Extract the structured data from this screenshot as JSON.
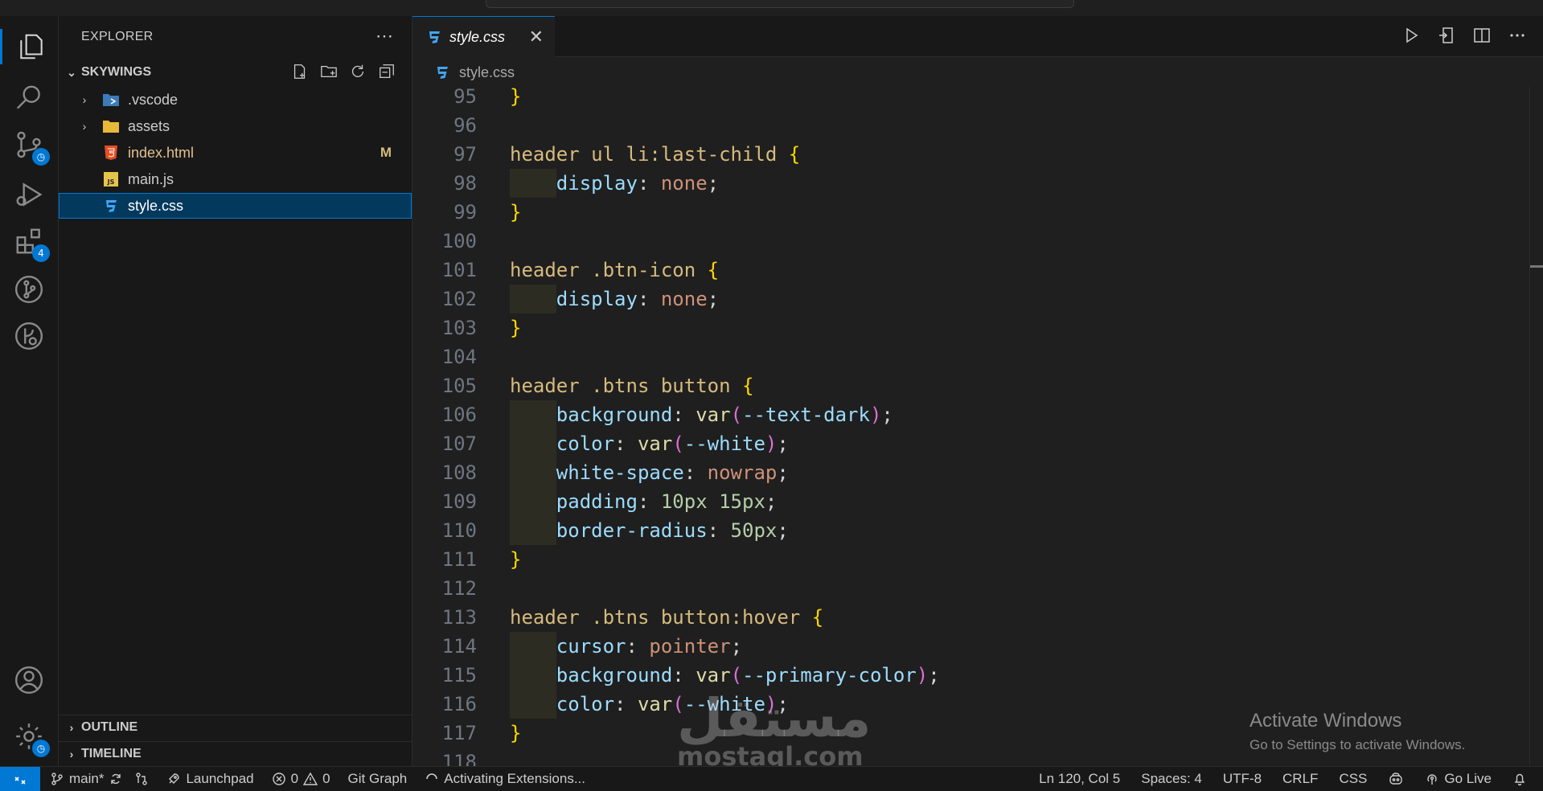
{
  "explorer": {
    "title": "EXPLORER",
    "workspace": "SKYWINGS",
    "items": [
      {
        "label": ".vscode",
        "type": "folder",
        "git": ""
      },
      {
        "label": "assets",
        "type": "folder",
        "git": ""
      },
      {
        "label": "index.html",
        "type": "html",
        "git": "M"
      },
      {
        "label": "main.js",
        "type": "js",
        "git": ""
      },
      {
        "label": "style.css",
        "type": "css",
        "git": ""
      }
    ],
    "outline_label": "OUTLINE",
    "timeline_label": "TIMELINE"
  },
  "activity": {
    "extensions_badge": "4"
  },
  "editor": {
    "tab_name": "style.css",
    "breadcrumb": "style.css"
  },
  "code_lines": [
    {
      "n": "95",
      "text": "}"
    },
    {
      "n": "96",
      "text": ""
    },
    {
      "n": "97",
      "text": "header ul li:last-child {"
    },
    {
      "n": "98",
      "text": "    display: none;"
    },
    {
      "n": "99",
      "text": "}"
    },
    {
      "n": "100",
      "text": ""
    },
    {
      "n": "101",
      "text": "header .btn-icon {"
    },
    {
      "n": "102",
      "text": "    display: none;"
    },
    {
      "n": "103",
      "text": "}"
    },
    {
      "n": "104",
      "text": ""
    },
    {
      "n": "105",
      "text": "header .btns button {"
    },
    {
      "n": "106",
      "text": "    background: var(--text-dark);"
    },
    {
      "n": "107",
      "text": "    color: var(--white);"
    },
    {
      "n": "108",
      "text": "    white-space: nowrap;"
    },
    {
      "n": "109",
      "text": "    padding: 10px 15px;"
    },
    {
      "n": "110",
      "text": "    border-radius: 50px;"
    },
    {
      "n": "111",
      "text": "}"
    },
    {
      "n": "112",
      "text": ""
    },
    {
      "n": "113",
      "text": "header .btns button:hover {"
    },
    {
      "n": "114",
      "text": "    cursor: pointer;"
    },
    {
      "n": "115",
      "text": "    background: var(--primary-color);"
    },
    {
      "n": "116",
      "text": "    color: var(--white);"
    },
    {
      "n": "117",
      "text": "}"
    },
    {
      "n": "118",
      "text": ""
    }
  ],
  "watermark": {
    "activate_title": "Activate Windows",
    "activate_sub": "Go to Settings to activate Windows.",
    "mostaql_ar": "مستقل",
    "mostaql_en": "mostaql.com"
  },
  "status": {
    "branch": "main*",
    "launchpad": "Launchpad",
    "errors": "0",
    "warnings": "0",
    "git_graph": "Git Graph",
    "activating": "Activating Extensions...",
    "position": "Ln 120, Col 5",
    "spaces": "Spaces: 4",
    "encoding": "UTF-8",
    "eol": "CRLF",
    "language": "CSS",
    "golive": "Go Live"
  },
  "colors": {
    "accent": "#0078d4",
    "selector": "#d7ba7d",
    "property": "#9cdcfe",
    "value": "#ce9178",
    "number": "#b5cea8"
  }
}
